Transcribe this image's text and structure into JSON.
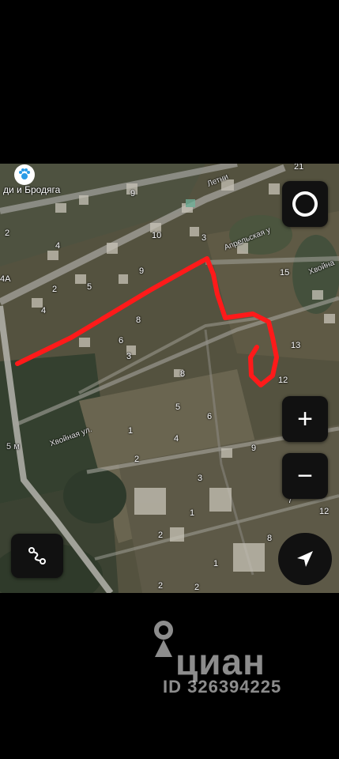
{
  "map": {
    "place_label": "ди и Бродяга",
    "streets": [
      "Хвойная ул.",
      "Апрельская у",
      "Хвойна",
      "Летни"
    ],
    "house_numbers": [
      "9",
      "10",
      "3",
      "2",
      "4",
      "5",
      "8",
      "9",
      "2",
      "4",
      "3",
      "6",
      "8",
      "15",
      "13",
      "12",
      "5",
      "6",
      "1",
      "4",
      "2",
      "9",
      "1",
      "7",
      "2",
      "12",
      "8",
      "2",
      "1",
      "3",
      "2",
      "21",
      "4А"
    ],
    "distance_label": "5 м",
    "route_color": "#ff1a1a"
  },
  "controls": {
    "layers_icon": "circle-icon",
    "zoom_in": "+",
    "zoom_out": "−",
    "route_icon": "route-icon",
    "navigate_icon": "navigation-arrow-icon"
  },
  "watermark": {
    "brand": "циан",
    "id_text": "ID 326394225"
  }
}
